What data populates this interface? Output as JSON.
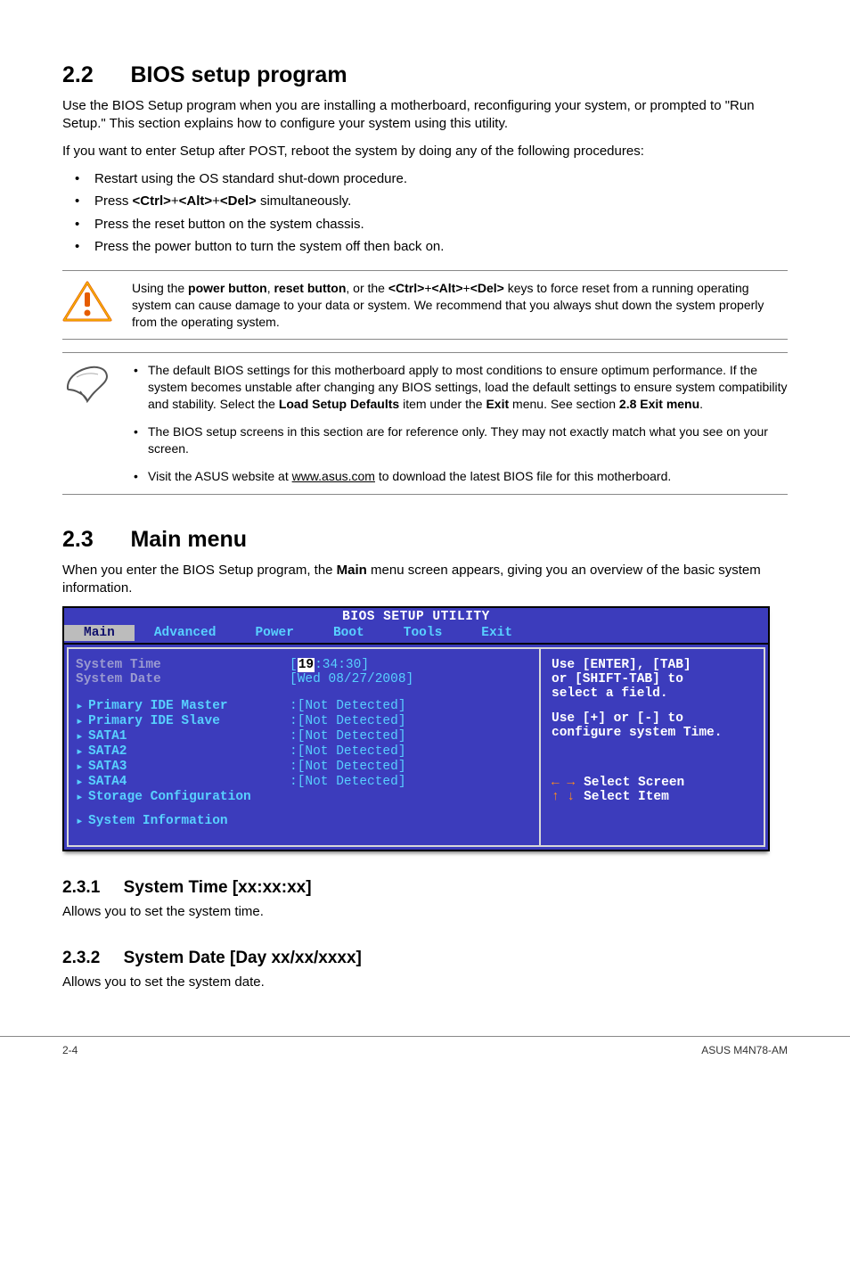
{
  "s22": {
    "heading_num": "2.2",
    "heading_title": "BIOS setup program",
    "para1": "Use the BIOS Setup program when you are installing a motherboard, reconfiguring your system, or prompted to \"Run Setup.\" This section explains how to configure your system using this utility.",
    "para2": "If you want to enter Setup after POST, reboot the system by doing any of the following procedures:",
    "bullets": {
      "b1": "Restart using the OS standard shut-down procedure.",
      "b2_a": "Press ",
      "b2_b1": "<Ctrl>",
      "b2_plus1": "+",
      "b2_b2": "<Alt>",
      "b2_plus2": "+",
      "b2_b3": "<Del>",
      "b2_c": " simultaneously.",
      "b3": "Press the reset button on the system chassis.",
      "b4": "Press the power button to turn the system off then back on."
    },
    "warn": {
      "t1": "Using the ",
      "bold1": "power button",
      "t2": ", ",
      "bold2": "reset button",
      "t3": ", or the ",
      "bold3": "<Ctrl>",
      "t4": "+",
      "bold4": "<Alt>",
      "t5": "+",
      "bold5": "<Del>",
      "t6": " keys to force reset from a running operating system can cause damage to your data or system. We recommend that you always shut down the system properly from the operating system."
    },
    "note": {
      "i1a": "The default BIOS settings for this motherboard apply to most conditions to ensure optimum performance. If the system becomes unstable after changing any BIOS settings, load the default settings to ensure system compatibility and stability. Select the ",
      "i1b": "Load Setup Defaults",
      "i1c": " item under the ",
      "i1d": "Exit",
      "i1e": " menu. See section ",
      "i1f": "2.8 Exit menu",
      "i1g": ".",
      "i2": "The BIOS setup screens in this section are for reference only. They may not exactly match what you see on your screen.",
      "i3a": "Visit the ASUS website at ",
      "i3b": "www.asus.com",
      "i3c": " to download the latest BIOS file for this motherboard."
    }
  },
  "s23": {
    "heading_num": "2.3",
    "heading_title": "Main menu",
    "para1a": "When you enter the BIOS Setup program, the ",
    "para1b": "Main",
    "para1c": " menu screen appears, giving you an overview of the basic system information."
  },
  "bios": {
    "title": "BIOS SETUP UTILITY",
    "tabs": {
      "main": "Main",
      "advanced": "Advanced",
      "power": "Power",
      "boot": "Boot",
      "tools": "Tools",
      "exit": "Exit"
    },
    "left": {
      "systime_label": "System Time",
      "systime_val_pre": "[",
      "systime_val_hl": "19",
      "systime_val_post": ":34:30]",
      "sysdate_label": "System Date",
      "sysdate_val": "[Wed 08/27/2008]",
      "items": {
        "r1_l": "Primary IDE Master",
        "r1_v": ":[Not Detected]",
        "r2_l": "Primary IDE Slave",
        "r2_v": ":[Not Detected]",
        "r3_l": "SATA1",
        "r3_v": ":[Not Detected]",
        "r4_l": "SATA2",
        "r4_v": ":[Not Detected]",
        "r5_l": "SATA3",
        "r5_v": ":[Not Detected]",
        "r6_l": "SATA4",
        "r6_v": ":[Not Detected]",
        "r7_l": "Storage Configuration",
        "r8_l": "System Information"
      }
    },
    "right": {
      "line1": "Use [ENTER], [TAB]",
      "line2": "or [SHIFT-TAB] to",
      "line3": "select a field.",
      "line4": "Use [+] or [-] to",
      "line5": "configure system Time.",
      "k1": "Select Screen",
      "k2": "Select Item"
    }
  },
  "s231": {
    "heading_num": "2.3.1",
    "heading_title": "System Time [xx:xx:xx]",
    "para": "Allows you to set the system time."
  },
  "s232": {
    "heading_num": "2.3.2",
    "heading_title": "System Date [Day xx/xx/xxxx]",
    "para": "Allows you to set the system date."
  },
  "footer": {
    "left": "2-4",
    "right": "ASUS M4N78-AM"
  }
}
